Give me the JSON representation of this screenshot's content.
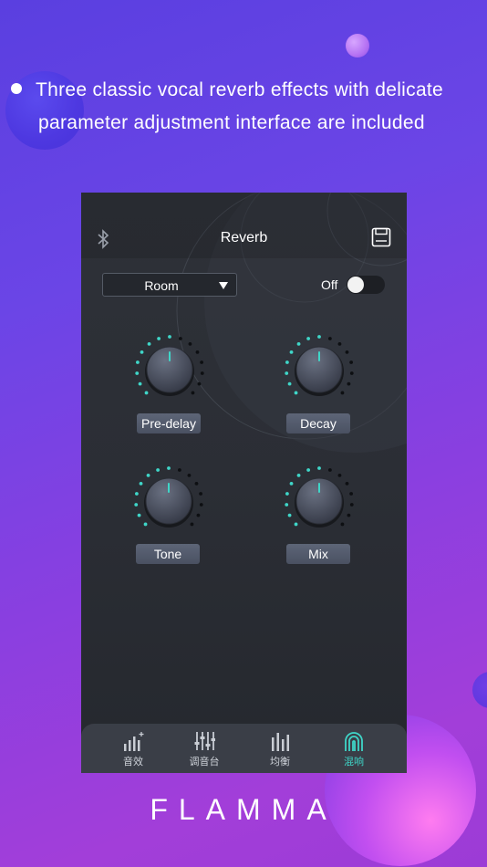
{
  "headline": {
    "line1": "Three classic vocal reverb effects with delicate",
    "line2": "parameter adjustment interface are included"
  },
  "app": {
    "title": "Reverb",
    "preset": "Room",
    "switch_label": "Off",
    "switch_on": false,
    "knobs": [
      {
        "label": "Pre-delay",
        "level": 0.5
      },
      {
        "label": "Decay",
        "level": 0.5
      },
      {
        "label": "Tone",
        "level": 0.5
      },
      {
        "label": "Mix",
        "level": 0.5
      }
    ],
    "tabs": [
      {
        "label": "音效",
        "icon": "effects-icon",
        "active": false
      },
      {
        "label": "调音台",
        "icon": "mixer-icon",
        "active": false
      },
      {
        "label": "均衡",
        "icon": "equalizer-icon",
        "active": false
      },
      {
        "label": "混响",
        "icon": "reverb-icon",
        "active": true
      }
    ]
  },
  "brand": "FLAMMA",
  "colors": {
    "accent": "#3fd6c8",
    "background": "#2e3138"
  }
}
